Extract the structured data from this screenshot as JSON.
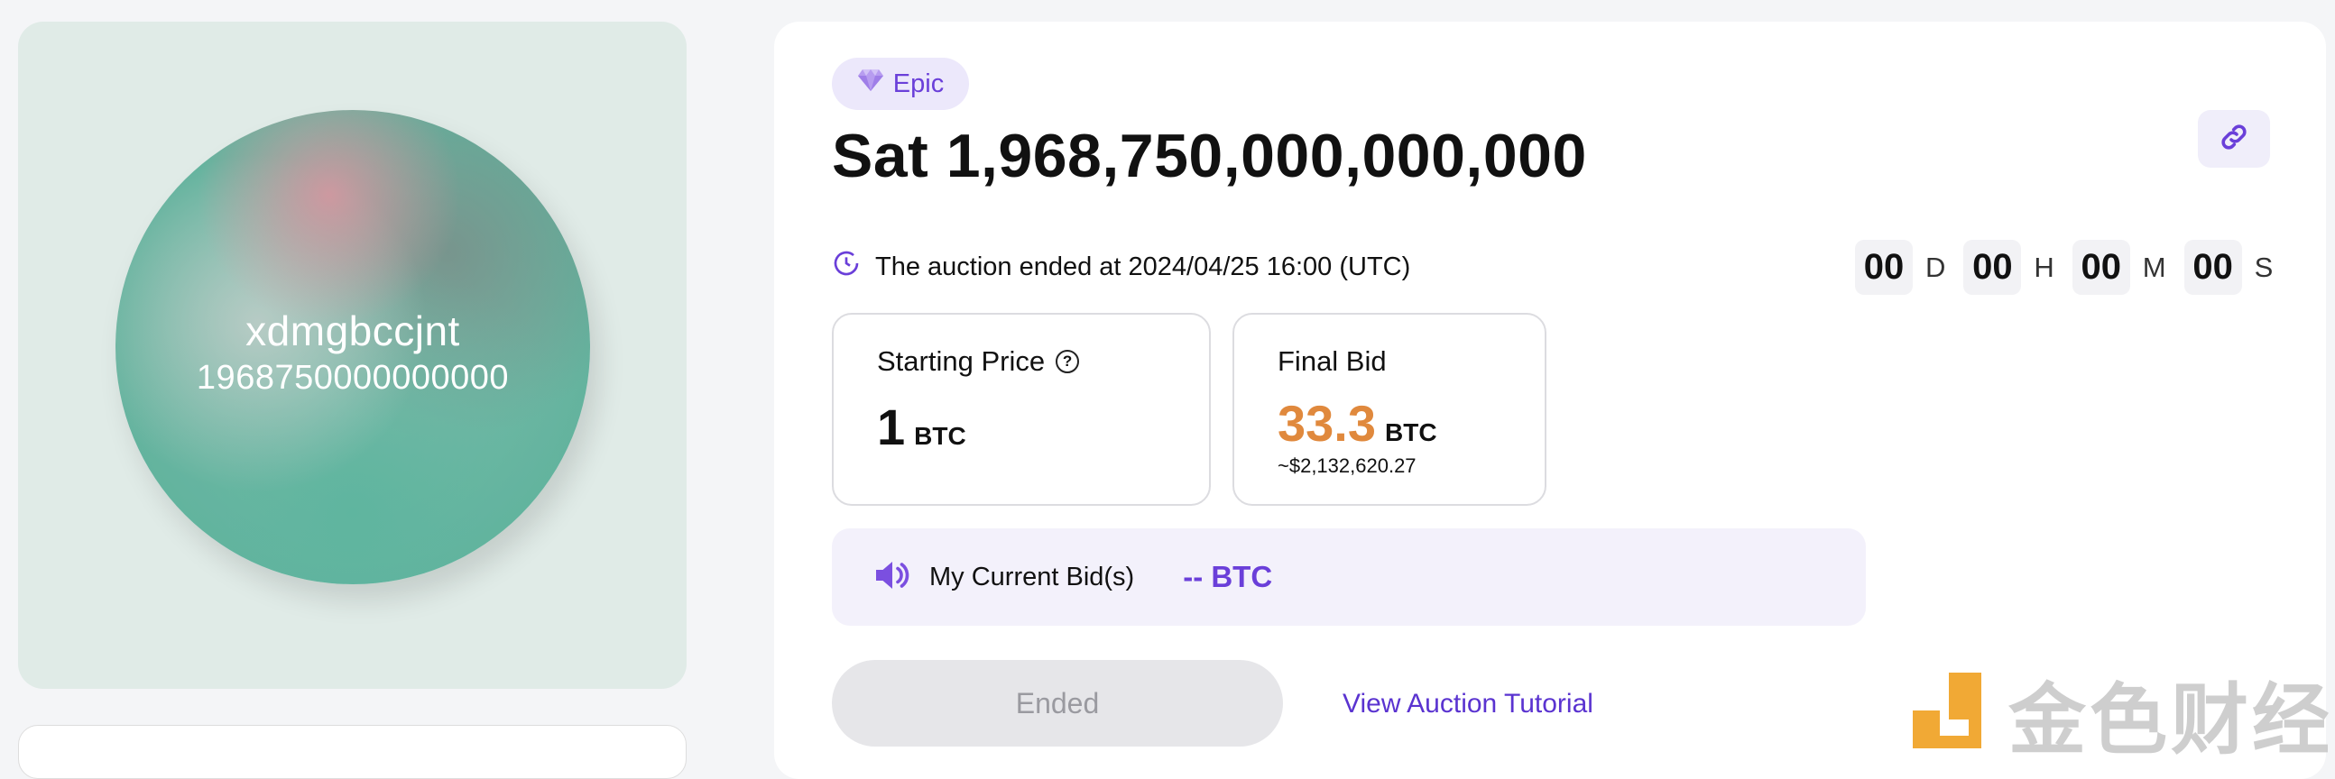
{
  "preview": {
    "name": "xdmgbccjnt",
    "number": "1968750000000000"
  },
  "header": {
    "rarity_badge": "Epic",
    "rarity_icon": "diamond-icon",
    "title": "Sat 1,968,750,000,000,000",
    "link_icon": "link-icon"
  },
  "status": {
    "clock_icon": "clock-icon",
    "text": "The auction ended at 2024/04/25 16:00 (UTC)"
  },
  "countdown": {
    "days": "00",
    "days_unit": "D",
    "hours": "00",
    "hours_unit": "H",
    "minutes": "00",
    "minutes_unit": "M",
    "seconds": "00",
    "seconds_unit": "S"
  },
  "starting_price": {
    "label": "Starting Price",
    "value": "1",
    "unit": "BTC"
  },
  "final_bid": {
    "label": "Final Bid",
    "value": "33.3",
    "unit": "BTC",
    "usd": "~$2,132,620.27"
  },
  "current_bid": {
    "icon": "speaker-icon",
    "label": "My Current Bid(s)",
    "value": "-- BTC"
  },
  "actions": {
    "ended_button": "Ended",
    "tutorial_link": "View Auction Tutorial"
  },
  "watermark": {
    "text": "金色财经"
  },
  "colors": {
    "accent": "#6a3fd9",
    "final_bid": "#e0893d",
    "watermark_logo": "#f0a020"
  }
}
